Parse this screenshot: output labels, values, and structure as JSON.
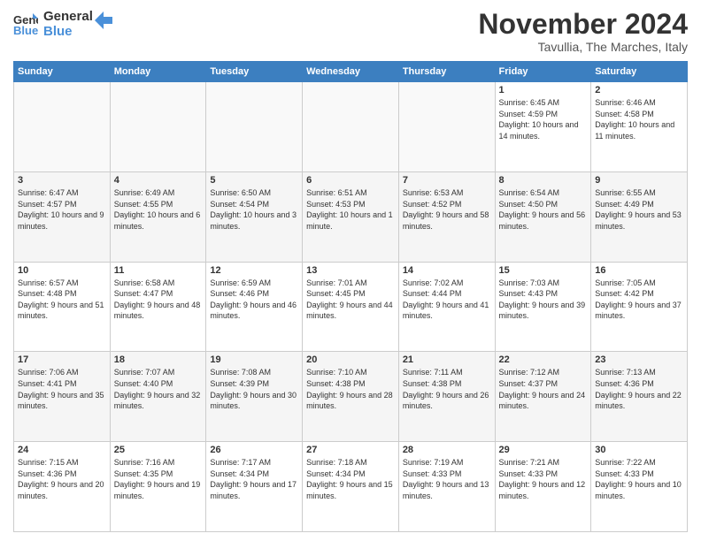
{
  "logo": {
    "line1": "General",
    "line2": "Blue"
  },
  "title": "November 2024",
  "subtitle": "Tavullia, The Marches, Italy",
  "days_of_week": [
    "Sunday",
    "Monday",
    "Tuesday",
    "Wednesday",
    "Thursday",
    "Friday",
    "Saturday"
  ],
  "weeks": [
    [
      {
        "day": "",
        "detail": ""
      },
      {
        "day": "",
        "detail": ""
      },
      {
        "day": "",
        "detail": ""
      },
      {
        "day": "",
        "detail": ""
      },
      {
        "day": "",
        "detail": ""
      },
      {
        "day": "1",
        "detail": "Sunrise: 6:45 AM\nSunset: 4:59 PM\nDaylight: 10 hours and 14 minutes."
      },
      {
        "day": "2",
        "detail": "Sunrise: 6:46 AM\nSunset: 4:58 PM\nDaylight: 10 hours and 11 minutes."
      }
    ],
    [
      {
        "day": "3",
        "detail": "Sunrise: 6:47 AM\nSunset: 4:57 PM\nDaylight: 10 hours and 9 minutes."
      },
      {
        "day": "4",
        "detail": "Sunrise: 6:49 AM\nSunset: 4:55 PM\nDaylight: 10 hours and 6 minutes."
      },
      {
        "day": "5",
        "detail": "Sunrise: 6:50 AM\nSunset: 4:54 PM\nDaylight: 10 hours and 3 minutes."
      },
      {
        "day": "6",
        "detail": "Sunrise: 6:51 AM\nSunset: 4:53 PM\nDaylight: 10 hours and 1 minute."
      },
      {
        "day": "7",
        "detail": "Sunrise: 6:53 AM\nSunset: 4:52 PM\nDaylight: 9 hours and 58 minutes."
      },
      {
        "day": "8",
        "detail": "Sunrise: 6:54 AM\nSunset: 4:50 PM\nDaylight: 9 hours and 56 minutes."
      },
      {
        "day": "9",
        "detail": "Sunrise: 6:55 AM\nSunset: 4:49 PM\nDaylight: 9 hours and 53 minutes."
      }
    ],
    [
      {
        "day": "10",
        "detail": "Sunrise: 6:57 AM\nSunset: 4:48 PM\nDaylight: 9 hours and 51 minutes."
      },
      {
        "day": "11",
        "detail": "Sunrise: 6:58 AM\nSunset: 4:47 PM\nDaylight: 9 hours and 48 minutes."
      },
      {
        "day": "12",
        "detail": "Sunrise: 6:59 AM\nSunset: 4:46 PM\nDaylight: 9 hours and 46 minutes."
      },
      {
        "day": "13",
        "detail": "Sunrise: 7:01 AM\nSunset: 4:45 PM\nDaylight: 9 hours and 44 minutes."
      },
      {
        "day": "14",
        "detail": "Sunrise: 7:02 AM\nSunset: 4:44 PM\nDaylight: 9 hours and 41 minutes."
      },
      {
        "day": "15",
        "detail": "Sunrise: 7:03 AM\nSunset: 4:43 PM\nDaylight: 9 hours and 39 minutes."
      },
      {
        "day": "16",
        "detail": "Sunrise: 7:05 AM\nSunset: 4:42 PM\nDaylight: 9 hours and 37 minutes."
      }
    ],
    [
      {
        "day": "17",
        "detail": "Sunrise: 7:06 AM\nSunset: 4:41 PM\nDaylight: 9 hours and 35 minutes."
      },
      {
        "day": "18",
        "detail": "Sunrise: 7:07 AM\nSunset: 4:40 PM\nDaylight: 9 hours and 32 minutes."
      },
      {
        "day": "19",
        "detail": "Sunrise: 7:08 AM\nSunset: 4:39 PM\nDaylight: 9 hours and 30 minutes."
      },
      {
        "day": "20",
        "detail": "Sunrise: 7:10 AM\nSunset: 4:38 PM\nDaylight: 9 hours and 28 minutes."
      },
      {
        "day": "21",
        "detail": "Sunrise: 7:11 AM\nSunset: 4:38 PM\nDaylight: 9 hours and 26 minutes."
      },
      {
        "day": "22",
        "detail": "Sunrise: 7:12 AM\nSunset: 4:37 PM\nDaylight: 9 hours and 24 minutes."
      },
      {
        "day": "23",
        "detail": "Sunrise: 7:13 AM\nSunset: 4:36 PM\nDaylight: 9 hours and 22 minutes."
      }
    ],
    [
      {
        "day": "24",
        "detail": "Sunrise: 7:15 AM\nSunset: 4:36 PM\nDaylight: 9 hours and 20 minutes."
      },
      {
        "day": "25",
        "detail": "Sunrise: 7:16 AM\nSunset: 4:35 PM\nDaylight: 9 hours and 19 minutes."
      },
      {
        "day": "26",
        "detail": "Sunrise: 7:17 AM\nSunset: 4:34 PM\nDaylight: 9 hours and 17 minutes."
      },
      {
        "day": "27",
        "detail": "Sunrise: 7:18 AM\nSunset: 4:34 PM\nDaylight: 9 hours and 15 minutes."
      },
      {
        "day": "28",
        "detail": "Sunrise: 7:19 AM\nSunset: 4:33 PM\nDaylight: 9 hours and 13 minutes."
      },
      {
        "day": "29",
        "detail": "Sunrise: 7:21 AM\nSunset: 4:33 PM\nDaylight: 9 hours and 12 minutes."
      },
      {
        "day": "30",
        "detail": "Sunrise: 7:22 AM\nSunset: 4:33 PM\nDaylight: 9 hours and 10 minutes."
      }
    ]
  ]
}
